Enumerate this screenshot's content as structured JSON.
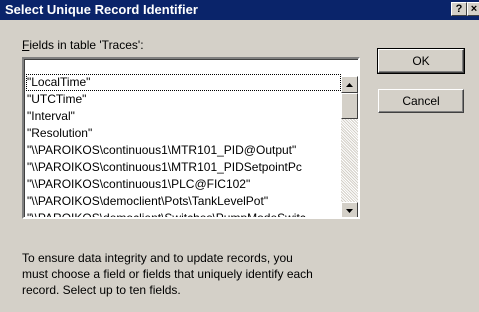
{
  "window": {
    "title": "Select Unique Record Identifier",
    "help_glyph": "?",
    "close_glyph": "×"
  },
  "fields": {
    "label_accel": "F",
    "label_rest": "ields in table 'Traces':",
    "items": [
      "\"LocalTime\"",
      "\"UTCTime\"",
      "\"Interval\"",
      "\"Resolution\"",
      "\"\\\\PAROIKOS\\continuous1\\MTR101_PID@Output\"",
      "\"\\\\PAROIKOS\\continuous1\\MTR101_PIDSetpointPc",
      "\"\\\\PAROIKOS\\continuous1\\PLC@FIC102\"",
      "\"\\\\PAROIKOS\\democlient\\Pots\\TankLevelPot\"",
      "\"\\\\PAROIKOS\\democlient\\Switches\\PumpModeSwitc"
    ]
  },
  "buttons": {
    "ok": "OK",
    "cancel": "Cancel"
  },
  "info": {
    "lines": [
      "To ensure data integrity and to update records, you",
      "must choose a field or fields that uniquely identify each",
      "record. Select up to ten fields."
    ]
  },
  "icons": {
    "scroll_up": "triangle-up-icon",
    "scroll_down": "triangle-down-icon"
  }
}
